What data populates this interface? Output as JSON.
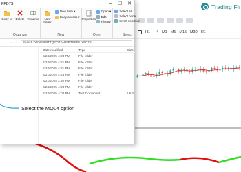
{
  "window": {
    "title": "FFD7S",
    "minimize": "–",
    "maximize": "☐",
    "close": "✕"
  },
  "ribbon": {
    "clipboard": {
      "copy_to": "Copy to",
      "delete": "Delete",
      "rename": "Rename",
      "group": "Organize"
    },
    "new": {
      "new_item": "New item ▾",
      "easy_access": "Easy access ▾",
      "new_folder": "New folder",
      "group": "New"
    },
    "open": {
      "properties": "Properties",
      "open": "Open ▾",
      "edit": "Edit",
      "history": "History",
      "group": "Open"
    },
    "select": {
      "select_all": "Select all",
      "select_none": "Select none",
      "invert": "Invert selection",
      "group": "Select"
    }
  },
  "address": {
    "path": "Search D0QG89PTTQEOT2AD8BTSSE5JYFD7S"
  },
  "file_list": {
    "headers": {
      "date": "Date modified",
      "type": "Type",
      "size": "Size"
    },
    "rows": [
      {
        "date": "8/24/2025 4:23 PM",
        "type": "File folder",
        "size": ""
      },
      {
        "date": "8/24/2025 4:21 PM",
        "type": "File folder",
        "size": ""
      },
      {
        "date": "8/24/2025 4:21 PM",
        "type": "File folder",
        "size": ""
      },
      {
        "date": "8/21/2025 4:23 PM",
        "type": "File folder",
        "size": ""
      },
      {
        "date": "8/21/2025 2:40 PM",
        "type": "File folder",
        "size": ""
      },
      {
        "date": "8/24/2025 4:23 PM",
        "type": "File folder",
        "size": ""
      },
      {
        "date": "8/24/2025 4:04 PM",
        "type": "Text Document",
        "size": "1 KB"
      }
    ]
  },
  "callout": {
    "text": "Select the MQL4 option"
  },
  "brand": {
    "name": "Trading Finder",
    "color": "#2a8c95"
  },
  "platform_toolbar": {
    "items": [
      "H1",
      "H4",
      "M1",
      "M5",
      "M15",
      "M30",
      "H1"
    ]
  },
  "colors": {
    "bull_candle": "#2a9d8f",
    "bear_candle": "#e05252",
    "ma_line": "#d62828",
    "indicator_up": "#33dd22",
    "indicator_down": "#e01010"
  }
}
